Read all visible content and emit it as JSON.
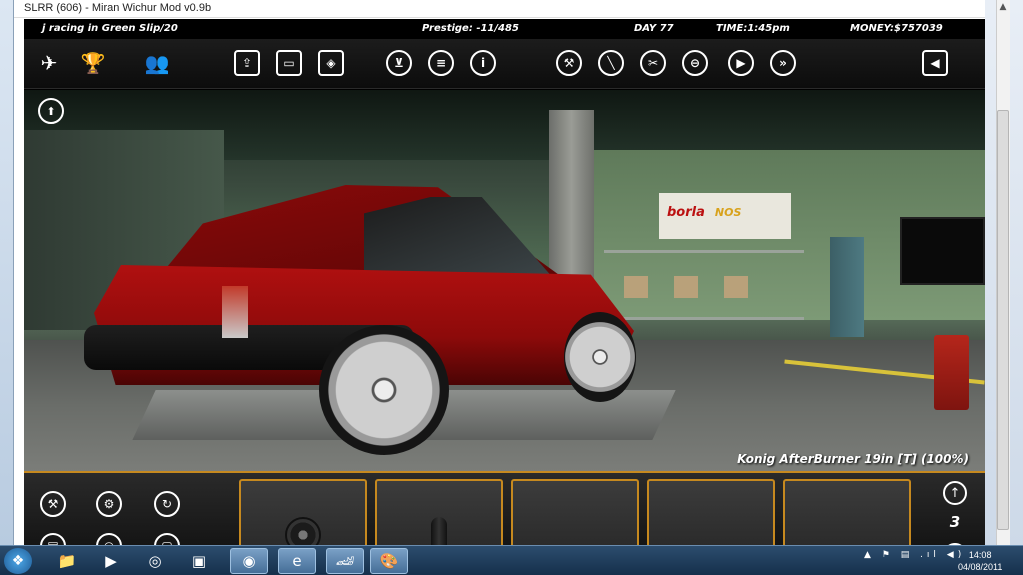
{
  "window": {
    "title": "SLRR (606) - Miran Wichur Mod v0.9b"
  },
  "hud": {
    "team": "j racing in Green Slip/20",
    "prestige": "Prestige: -11/485",
    "day": "DAY 77",
    "time": "TIME:1:45pm",
    "money": "MONEY:$757039"
  },
  "toolbar": {
    "icons": [
      "logo-icon",
      "trophy-icon",
      "people-icon",
      "car-lift-icon",
      "car-front-icon",
      "car-paint-icon",
      "shop-cart-icon",
      "list-icon",
      "info-icon",
      "wrench-icon",
      "screwdriver-icon",
      "tools-icon",
      "steering-wheel-icon",
      "play-icon",
      "fast-forward-icon",
      "exit-icon"
    ]
  },
  "scene": {
    "sign_brand": "borla",
    "sign_brand2": "NOS",
    "status": "Konig AfterBurner 19in [T] (100%)"
  },
  "bottom": {
    "page": "3",
    "slots": [
      "tire",
      "tire-side",
      "",
      "",
      ""
    ]
  },
  "taskbar": {
    "time": "14:08",
    "date": "04/08/2011"
  },
  "colors": {
    "accent": "#c6891f",
    "car": "#a50d0d"
  }
}
